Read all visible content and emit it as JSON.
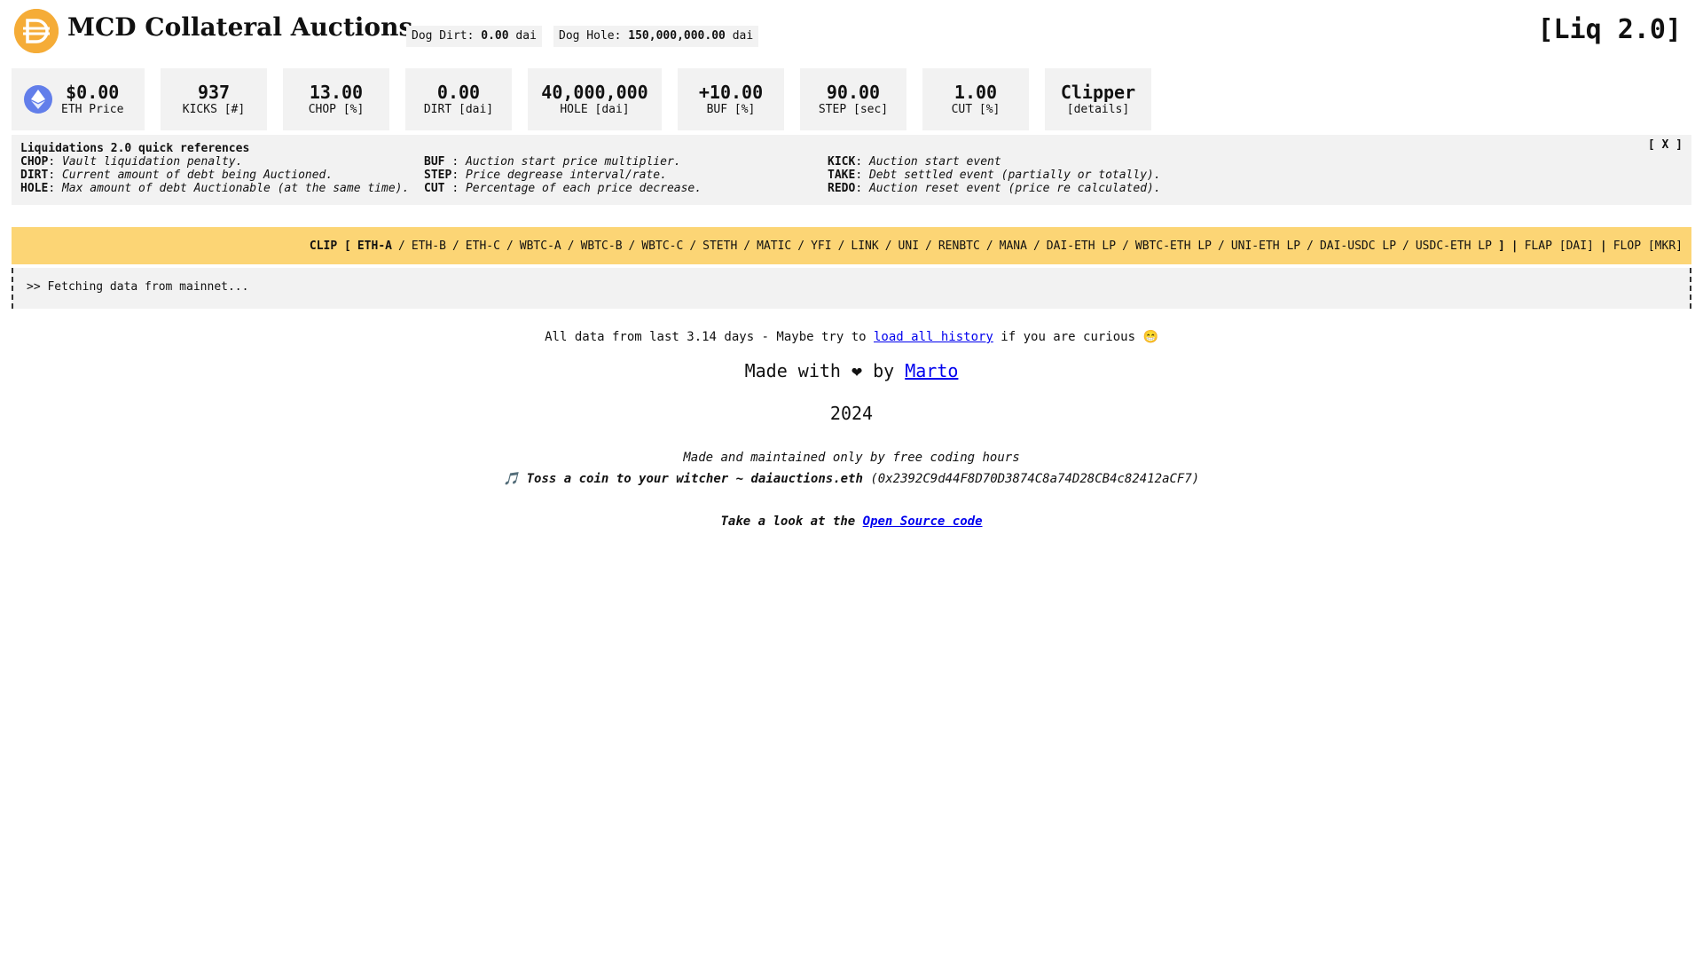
{
  "header": {
    "title": "MCD Collateral Auctions",
    "version": "[Liq 2.0]",
    "dog_dirt": {
      "label": "Dog Dirt:",
      "value": "0.00",
      "unit": "dai"
    },
    "dog_hole": {
      "label": "Dog Hole:",
      "value": "150,000,000.00",
      "unit": "dai"
    }
  },
  "cards": {
    "eth": {
      "value": "$0.00",
      "label": "ETH Price"
    },
    "kicks": {
      "value": "937",
      "label": "KICKS [#]"
    },
    "chop": {
      "value": "13.00",
      "label": "CHOP [%]"
    },
    "dirt": {
      "value": "0.00",
      "label": "DIRT [dai]"
    },
    "hole": {
      "value": "40,000,000",
      "label": "HOLE [dai]"
    },
    "buf": {
      "value": "+10.00",
      "label": "BUF [%]"
    },
    "step": {
      "value": "90.00",
      "label": "STEP [sec]"
    },
    "cut": {
      "value": "1.00",
      "label": "CUT [%]"
    },
    "clipper": {
      "value": "Clipper",
      "label": "[details]"
    }
  },
  "refs": {
    "title": "Liquidations 2.0 quick references",
    "close": "[ X ]",
    "col1": [
      {
        "key": "CHOP",
        "desc": "Vault liquidation penalty."
      },
      {
        "key": "DIRT",
        "desc": "Current amount of debt being Auctioned."
      },
      {
        "key": "HOLE",
        "desc": "Max amount of debt Auctionable (at the same time)."
      }
    ],
    "col2": [
      {
        "key": "BUF ",
        "desc": "Auction start price multiplier."
      },
      {
        "key": "STEP",
        "desc": "Price degrease interval/rate."
      },
      {
        "key": "CUT ",
        "desc": "Percentage of each price decrease."
      }
    ],
    "col3": [
      {
        "key": "KICK",
        "desc": "Auction start event"
      },
      {
        "key": "TAKE",
        "desc": "Debt settled event (partially or totally)."
      },
      {
        "key": "REDO",
        "desc": "Auction reset event (price re calculated)."
      }
    ]
  },
  "nav": {
    "clip_label": "CLIP [",
    "clip_close": "]",
    "items": [
      "ETH-A",
      "ETH-B",
      "ETH-C",
      "WBTC-A",
      "WBTC-B",
      "WBTC-C",
      "STETH",
      "MATIC",
      "YFI",
      "LINK",
      "UNI",
      "RENBTC",
      "MANA",
      "DAI-ETH LP",
      "WBTC-ETH LP",
      "UNI-ETH LP",
      "DAI-USDC LP",
      "USDC-ETH LP"
    ],
    "active": "ETH-A",
    "flap": "FLAP [DAI]",
    "flop": "FLOP [MKR]"
  },
  "console": {
    "text": ">> Fetching data from mainnet..."
  },
  "footer": {
    "history_prefix": "All data from last 3.14 days - Maybe try to",
    "history_link": "load all history",
    "history_suffix": "if you are curious 😁",
    "made_prefix": "Made with ❤ by",
    "made_link": "Marto",
    "year": "2024",
    "free_hours": "Made and maintained only by free coding hours",
    "coin_note": "🎵",
    "coin_text": "Toss a coin to your witcher ~ daiauctions.eth",
    "coin_address": "(0x2392C9d44F8D70D3874C8a74D28CB4c82412aCF7)",
    "source_prefix": "Take a look at the",
    "source_link": "Open Source code"
  }
}
